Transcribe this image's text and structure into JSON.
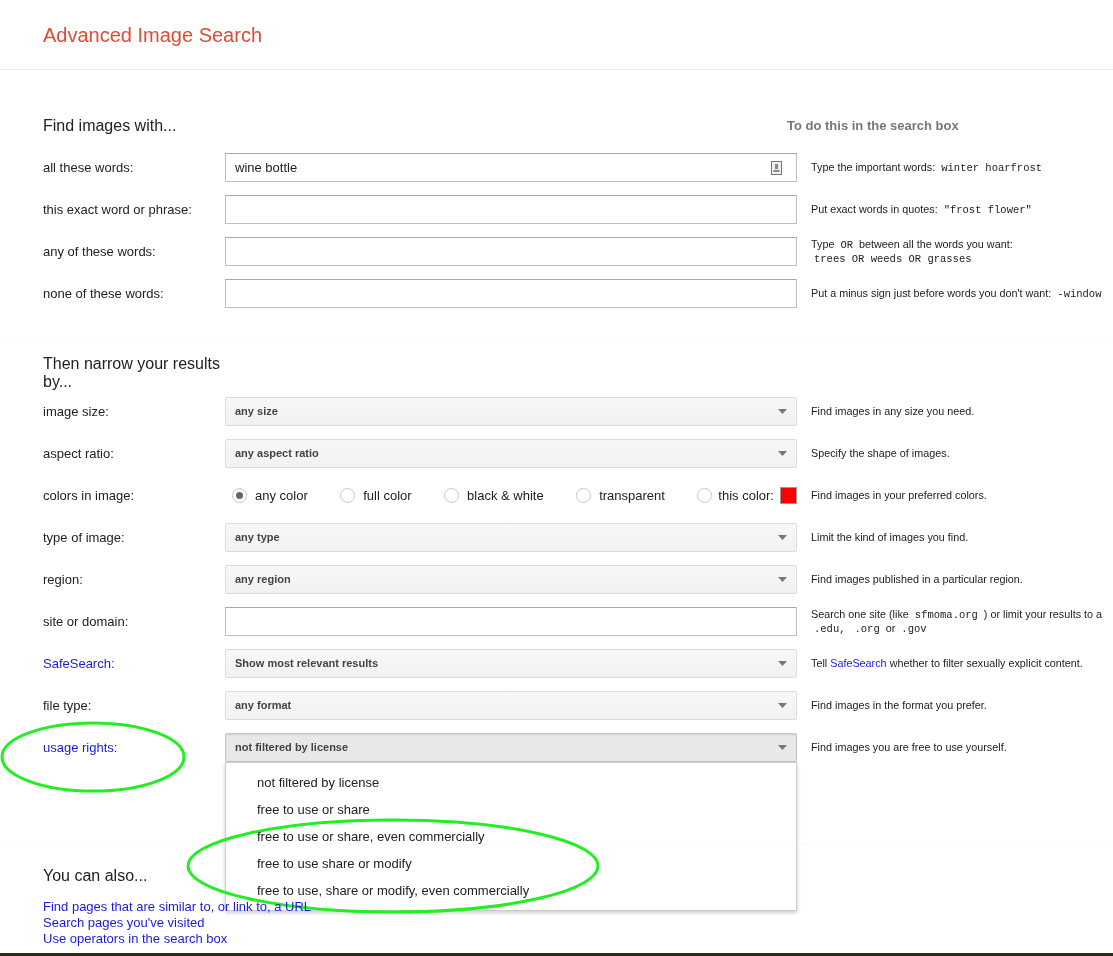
{
  "header": {
    "title": "Advanced Image Search"
  },
  "find_section": {
    "heading": "Find images with...",
    "hint_heading": "To do this in the search box",
    "rows": [
      {
        "label": "all these words:",
        "value": "wine bottle",
        "keyboard": true,
        "hint": [
          {
            "kind": "text",
            "text": "Type the important words:"
          },
          {
            "kind": "code",
            "text": "winter hoarfrost"
          }
        ]
      },
      {
        "label": "this exact word or phrase:",
        "keyboard": false,
        "hint": [
          {
            "kind": "text",
            "text": "Put exact words in quotes:"
          },
          {
            "kind": "code",
            "text": "\"frost flower\""
          }
        ]
      },
      {
        "label": "any of these words:",
        "keyboard": false,
        "hint": [
          {
            "kind": "text",
            "text": "Type"
          },
          {
            "kind": "code",
            "text": "OR"
          },
          {
            "kind": "text",
            "text": "between all the words you want:"
          },
          {
            "kind": "break"
          },
          {
            "kind": "code",
            "text": "trees OR weeds OR grasses"
          }
        ]
      },
      {
        "label": "none of these words:",
        "keyboard": false,
        "hint": [
          {
            "kind": "text",
            "text": "Put a minus sign just before words you don't want:"
          },
          {
            "kind": "code",
            "text": "-window"
          }
        ]
      }
    ]
  },
  "narrow_section": {
    "heading": "Then narrow your results by...",
    "rows": [
      {
        "kind": "select",
        "label": "image size:",
        "label_link": false,
        "value": "any size",
        "open": false,
        "hint": [
          {
            "kind": "text",
            "text": "Find images in any size you need."
          }
        ]
      },
      {
        "kind": "select",
        "label": "aspect ratio:",
        "label_link": false,
        "value": "any aspect ratio",
        "open": false,
        "hint": [
          {
            "kind": "text",
            "text": "Specify the shape of images."
          }
        ]
      },
      {
        "kind": "radio",
        "label": "colors in image:",
        "label_link": false,
        "options": [
          {
            "label": "any color",
            "selected": true
          },
          {
            "label": "full color",
            "selected": false
          },
          {
            "label": "black & white",
            "selected": false
          },
          {
            "label": "transparent",
            "selected": false
          },
          {
            "label": "this color:",
            "selected": false,
            "color": "#ff0000"
          }
        ],
        "hint": [
          {
            "kind": "text",
            "text": "Find images in your preferred colors."
          }
        ]
      },
      {
        "kind": "select",
        "label": "type of image:",
        "label_link": false,
        "value": "any type",
        "open": false,
        "hint": [
          {
            "kind": "text",
            "text": "Limit the kind of images you find."
          }
        ]
      },
      {
        "kind": "select",
        "label": "region:",
        "label_link": false,
        "value": "any region",
        "open": false,
        "hint": [
          {
            "kind": "text",
            "text": "Find images published in a particular region."
          }
        ]
      },
      {
        "kind": "text",
        "label": "site or domain:",
        "label_link": false,
        "hint": [
          {
            "kind": "text",
            "text": "Search one site (like"
          },
          {
            "kind": "code",
            "text": "sfmoma.org"
          },
          {
            "kind": "text",
            "text": ") or limit your results to a"
          },
          {
            "kind": "break"
          },
          {
            "kind": "code",
            "text": ".edu,"
          },
          {
            "kind": "code",
            "text": ".org"
          },
          {
            "kind": "text",
            "text": "or"
          },
          {
            "kind": "code",
            "text": ".gov"
          }
        ]
      },
      {
        "kind": "select",
        "label": "SafeSearch:",
        "label_link": true,
        "value": "Show most relevant results",
        "open": false,
        "hint": [
          {
            "kind": "text",
            "text": "Tell"
          },
          {
            "kind": "link",
            "text": "SafeSearch"
          },
          {
            "kind": "text",
            "text": "whether to filter sexually explicit content."
          }
        ]
      },
      {
        "kind": "select",
        "label": "file type:",
        "label_link": false,
        "value": "any format",
        "open": false,
        "hint": [
          {
            "kind": "text",
            "text": "Find images in the format you prefer."
          }
        ]
      },
      {
        "kind": "select",
        "label": "usage rights:",
        "label_link": true,
        "value": "not filtered by license",
        "open": true,
        "options": [
          "not filtered by license",
          "free to use or share",
          "free to use or share, even commercially",
          "free to use share or modify",
          "free to use, share or modify, even commercially"
        ],
        "hint": [
          {
            "kind": "text",
            "text": "Find images you are free to use yourself."
          }
        ]
      }
    ]
  },
  "also_section": {
    "heading": "You can also...",
    "links": [
      "Find pages that are similar to, or link to, a URL",
      "Search pages you've visited",
      "Use operators in the search box"
    ]
  }
}
